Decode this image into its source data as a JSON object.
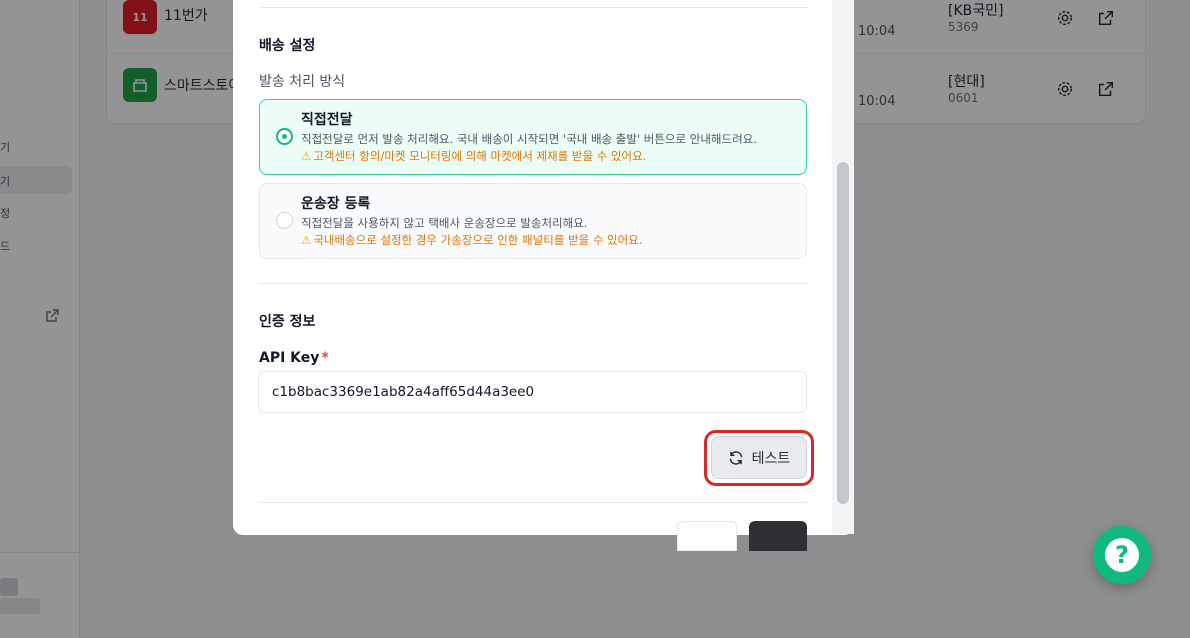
{
  "background": {
    "sidebar_fragments": [
      "기",
      "기",
      "정",
      "드"
    ],
    "rows": [
      {
        "logo_text": "11",
        "logo_color": "#e11d26",
        "name": "11번가",
        "time": "10:04",
        "bank": "[KB국민]",
        "bank_sub": "5369"
      },
      {
        "logo_text": "",
        "logo_color": "#22a447",
        "name": "스마트스토어",
        "time": "10:04",
        "bank": "[현대]",
        "bank_sub": "0601"
      }
    ]
  },
  "modal": {
    "shipping": {
      "title": "배송 설정",
      "method_label": "발송 처리 방식",
      "options": [
        {
          "title": "직접전달",
          "desc": "직접전달로 먼저 발송 처리해요. 국내 배송이 시작되면 '국내 배송 출발' 버튼으로 안내해드려요.",
          "warn": "고객센터 항의/마켓 모니터링에 의해 마켓에서 제재를 받을 수 있어요.",
          "selected": true
        },
        {
          "title": "운송장 등록",
          "desc": "직접전달을 사용하지 않고 택배사 운송장으로 발송처리해요.",
          "warn": "국내배송으로 설정한 경우 가송장으로 인한 패널티를 받을 수 있어요.",
          "selected": false
        }
      ]
    },
    "auth": {
      "title": "인증 정보",
      "api_key_label": "API Key",
      "required_mark": "*",
      "api_key_value": "c1b8bac3369e1ab82a4aff65d44a3ee0",
      "test_label": "테스트"
    }
  },
  "colors": {
    "accent": "#10b981",
    "warning": "#d97706",
    "highlight": "#dc2626"
  },
  "icons": {
    "test": "refresh-icon",
    "help": "question-icon",
    "row_settings": "gear-icon",
    "row_open": "external-link-icon",
    "warn": "warning-icon"
  }
}
